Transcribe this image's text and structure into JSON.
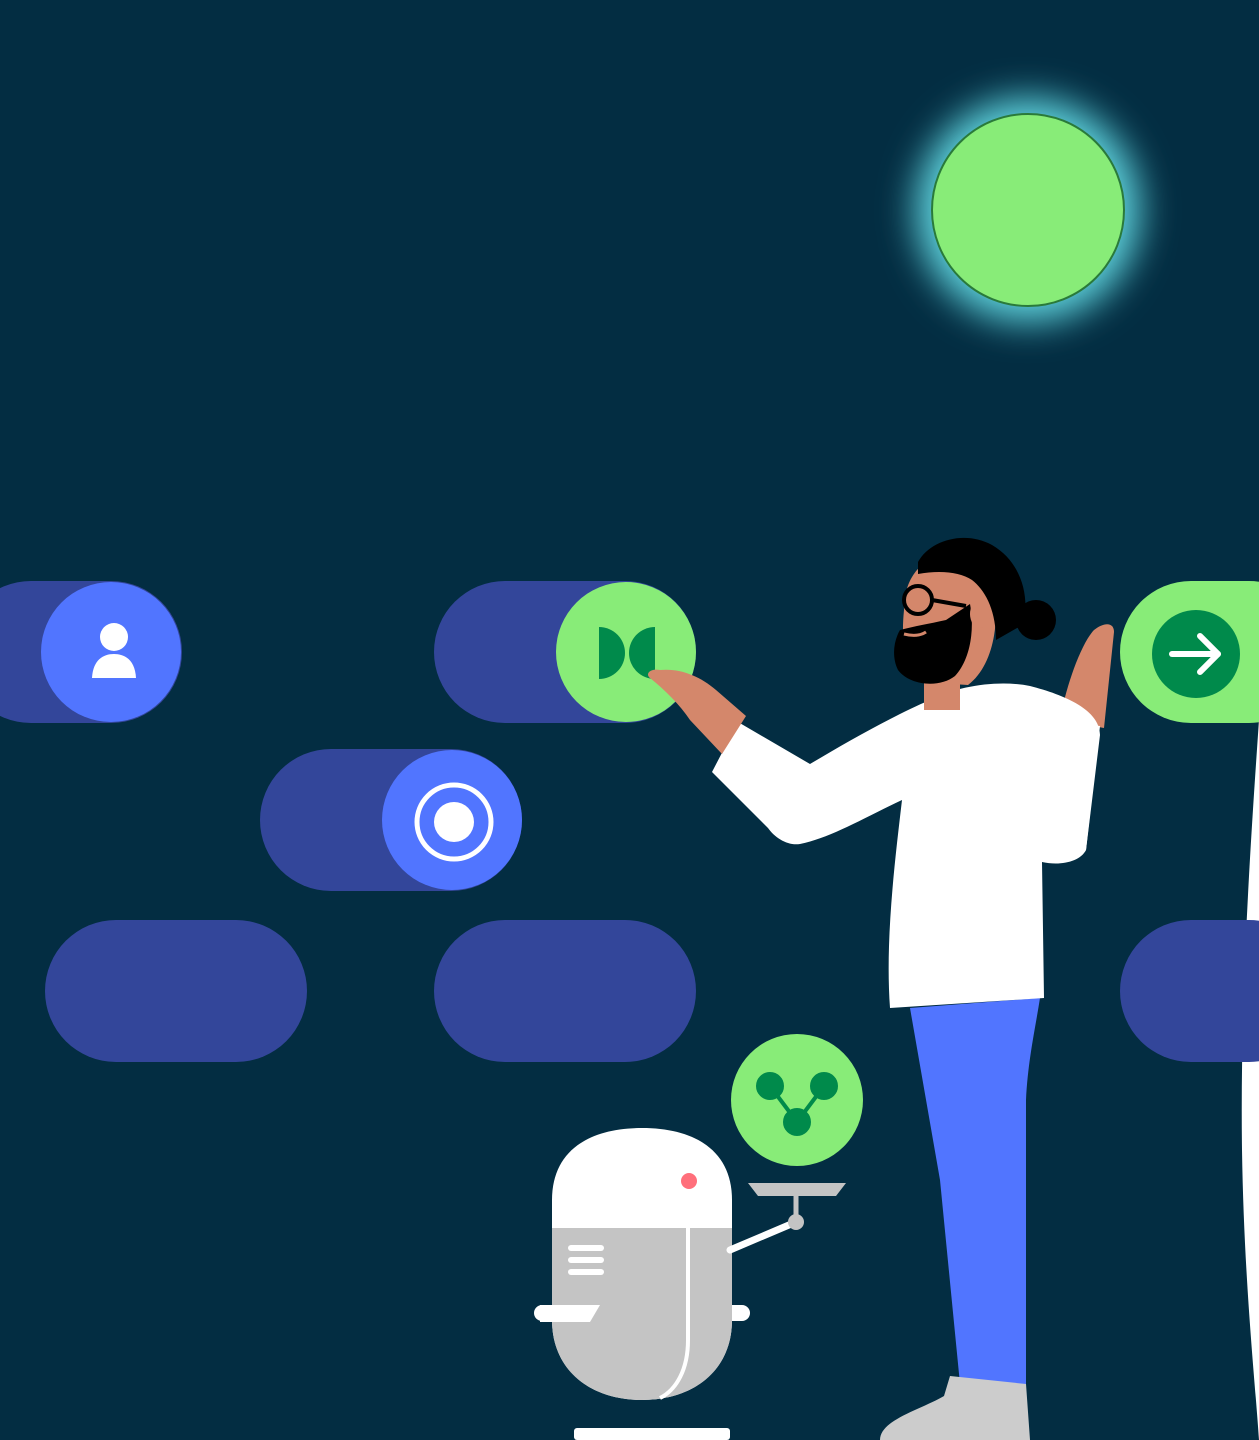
{
  "colors": {
    "background": "#032D42",
    "edge": "#ffffff",
    "toggle_track": "#33469A",
    "toggle_knob_blue": "#5175FF",
    "toggle_knob_green": "#88EC78",
    "icon_dark_green": "#008A4B",
    "sun": "#88EC78",
    "sun_glow": "#5FD4DE",
    "skin": "#D4876B",
    "hair": "#000000",
    "shirt": "#FFFFFF",
    "pants": "#5175FF",
    "shoe": "#CCCCCC",
    "robot_body": "#FFFFFF",
    "robot_panel": "#C4C4C4",
    "robot_eye": "#FF6F7B"
  },
  "illustration": {
    "toggles": [
      {
        "id": "toggle-user",
        "state": "on",
        "icon": "user-icon",
        "knob": "blue"
      },
      {
        "id": "toggle-dolby",
        "state": "on",
        "icon": "dolby-icon",
        "knob": "green"
      },
      {
        "id": "toggle-arrow",
        "state": "on",
        "icon": "arrow-right-icon",
        "knob": "green"
      },
      {
        "id": "toggle-radio",
        "state": "on",
        "icon": "radio-icon",
        "knob": "blue"
      },
      {
        "id": "toggle-empty-1",
        "state": "off",
        "icon": "",
        "knob": "none"
      },
      {
        "id": "toggle-empty-2",
        "state": "off",
        "icon": "",
        "knob": "none"
      },
      {
        "id": "toggle-empty-3",
        "state": "off",
        "icon": "",
        "knob": "none"
      }
    ],
    "characters": [
      "person-with-glasses",
      "robot-waiter"
    ],
    "robot_tray_icon": "network-nodes-icon",
    "sun": "glowing-green-circle"
  }
}
